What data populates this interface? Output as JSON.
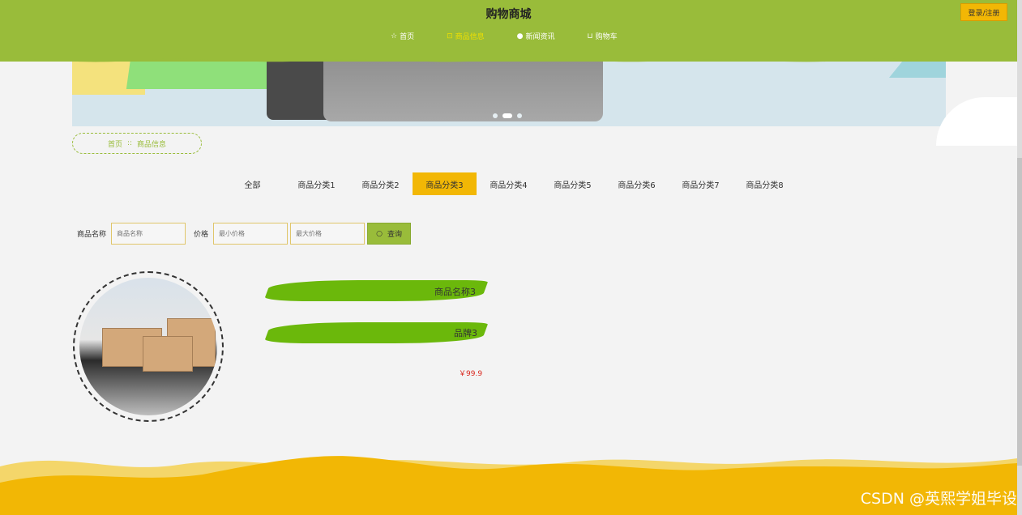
{
  "header": {
    "title": "购物商城",
    "login_label": "登录/注册",
    "nav": [
      {
        "label": "首页",
        "icon": "star-icon"
      },
      {
        "label": "商品信息",
        "icon": "bag-icon"
      },
      {
        "label": "新闻资讯",
        "icon": "info-icon"
      },
      {
        "label": "购物车",
        "icon": "cart-icon"
      }
    ],
    "active_nav": 1
  },
  "breadcrumb": {
    "home": "首页",
    "separator": "::",
    "current": "商品信息"
  },
  "tabs": [
    "全部",
    "商品分类1",
    "商品分类2",
    "商品分类3",
    "商品分类4",
    "商品分类5",
    "商品分类6",
    "商品分类7",
    "商品分类8"
  ],
  "active_tab": 3,
  "search": {
    "name_label": "商品名称",
    "name_placeholder": "商品名称",
    "price_label": "价格",
    "min_placeholder": "最小价格",
    "max_placeholder": "最大价格",
    "button_label": "查询"
  },
  "product": {
    "name": "商品名称3",
    "brand": "品牌3",
    "price": "￥99.9"
  },
  "carousel": {
    "slides": 3,
    "active": 1
  },
  "watermark": "CSDN @英熙学姐毕设",
  "colors": {
    "header": "#99bc3a",
    "accent": "#f2b705",
    "price": "#d9261c"
  }
}
